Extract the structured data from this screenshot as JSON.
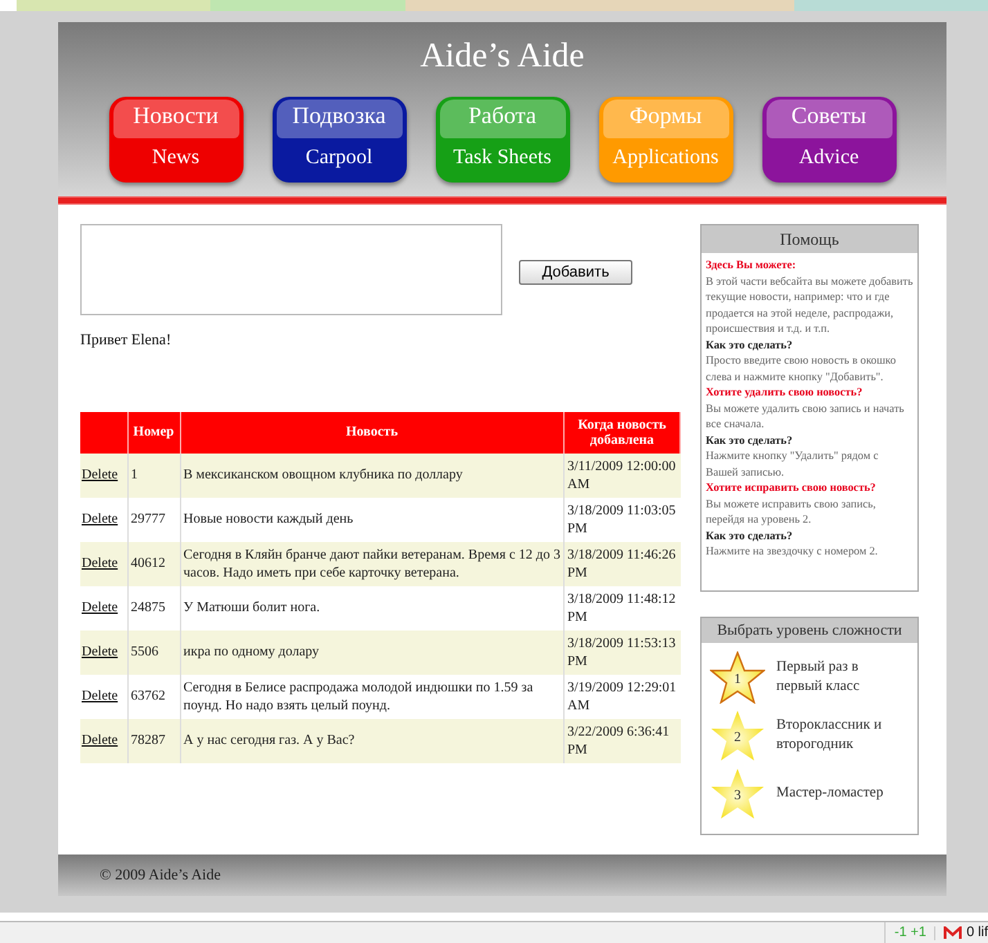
{
  "header": {
    "title": "Aide’s Aide"
  },
  "nav": [
    {
      "label_ru": "Новости",
      "label_en": "News",
      "color": "#ee0000"
    },
    {
      "label_ru": "Подвозка",
      "label_en": "Carpool",
      "color": "#0a1aa0"
    },
    {
      "label_ru": "Работа",
      "label_en": "Task Sheets",
      "color": "#16a016"
    },
    {
      "label_ru": "Формы",
      "label_en": "Applications",
      "color": "#ff9a00"
    },
    {
      "label_ru": "Советы",
      "label_en": "Advice",
      "color": "#8c149c"
    }
  ],
  "add_button": "Добавить",
  "greeting": "Привет Elena!",
  "table": {
    "columns": [
      "Номер",
      "Новость",
      "Когда новость добавлена"
    ],
    "rows": [
      {
        "action": "Delete",
        "number": "1",
        "news": "В мексиканском овощном клубника по доллару",
        "date": "3/11/2009 12:00:00 AM"
      },
      {
        "action": "Delete",
        "number": "29777",
        "news": "Новые новости каждый день",
        "date": "3/18/2009 11:03:05 PM"
      },
      {
        "action": "Delete",
        "number": "40612",
        "news": "Сегодня в Кляйн бранче дают пайки ветеранам. Время с 12 до 3 часов. Надо иметь при себе карточку ветерана.",
        "date": "3/18/2009 11:46:26 PM"
      },
      {
        "action": "Delete",
        "number": "24875",
        "news": "У Матюши болит нога.",
        "date": "3/18/2009 11:48:12 PM"
      },
      {
        "action": "Delete",
        "number": "5506",
        "news": "икра по одному долару",
        "date": "3/18/2009 11:53:13 PM"
      },
      {
        "action": "Delete",
        "number": "63762",
        "news": "Сегодня в Белисе распродажа молодой индюшки по 1.59 за поунд. Но надо взять целый поунд.",
        "date": "3/19/2009 12:29:01 AM"
      },
      {
        "action": "Delete",
        "number": "78287",
        "news": "А у нас сегодня газ. А у Вас?",
        "date": "3/22/2009 6:36:41 PM"
      }
    ]
  },
  "help": {
    "title": "Помощь",
    "items": [
      {
        "kind": "alert",
        "text": "Здесь Вы можете:"
      },
      {
        "kind": "text",
        "text": "В этой части вебсайта вы можете добавить текущие новости, например: что и где продается на этой неделе, распродажи, происшествия и т.д. и т.п."
      },
      {
        "kind": "question",
        "text": "Как это сделать?"
      },
      {
        "kind": "text",
        "text": "Просто введите свою новость в окошко слева и нажмите кнопку \"Добавить\"."
      },
      {
        "kind": "alert",
        "text": "Хотите удалить свою новость?"
      },
      {
        "kind": "text",
        "text": "Вы можете удалить свою запись и начать все сначала."
      },
      {
        "kind": "question",
        "text": "Как это сделать?"
      },
      {
        "kind": "text",
        "text": "Нажмите кнопку \"Удалить\" рядом с Вашей записью."
      },
      {
        "kind": "alert",
        "text": "Хотите исправить свою новость?"
      },
      {
        "kind": "text",
        "text": "Вы можете исправить свою запись, перейдя на уровень 2."
      },
      {
        "kind": "question",
        "text": "Как это сделать?"
      },
      {
        "kind": "text",
        "text": "Нажмите на звездочку с номером 2."
      }
    ]
  },
  "levels": {
    "title": "Выбрать уровень сложности",
    "items": [
      {
        "number": "1",
        "label": "Первый раз в первый класс",
        "selected": true
      },
      {
        "number": "2",
        "label": "Второклассник и второгодник",
        "selected": false
      },
      {
        "number": "3",
        "label": "Мастер-ломастер",
        "selected": false
      }
    ]
  },
  "footer": "© 2009 Aide’s Aide",
  "status_bar": {
    "counter": "-1 +1",
    "mail": "0 lif"
  }
}
